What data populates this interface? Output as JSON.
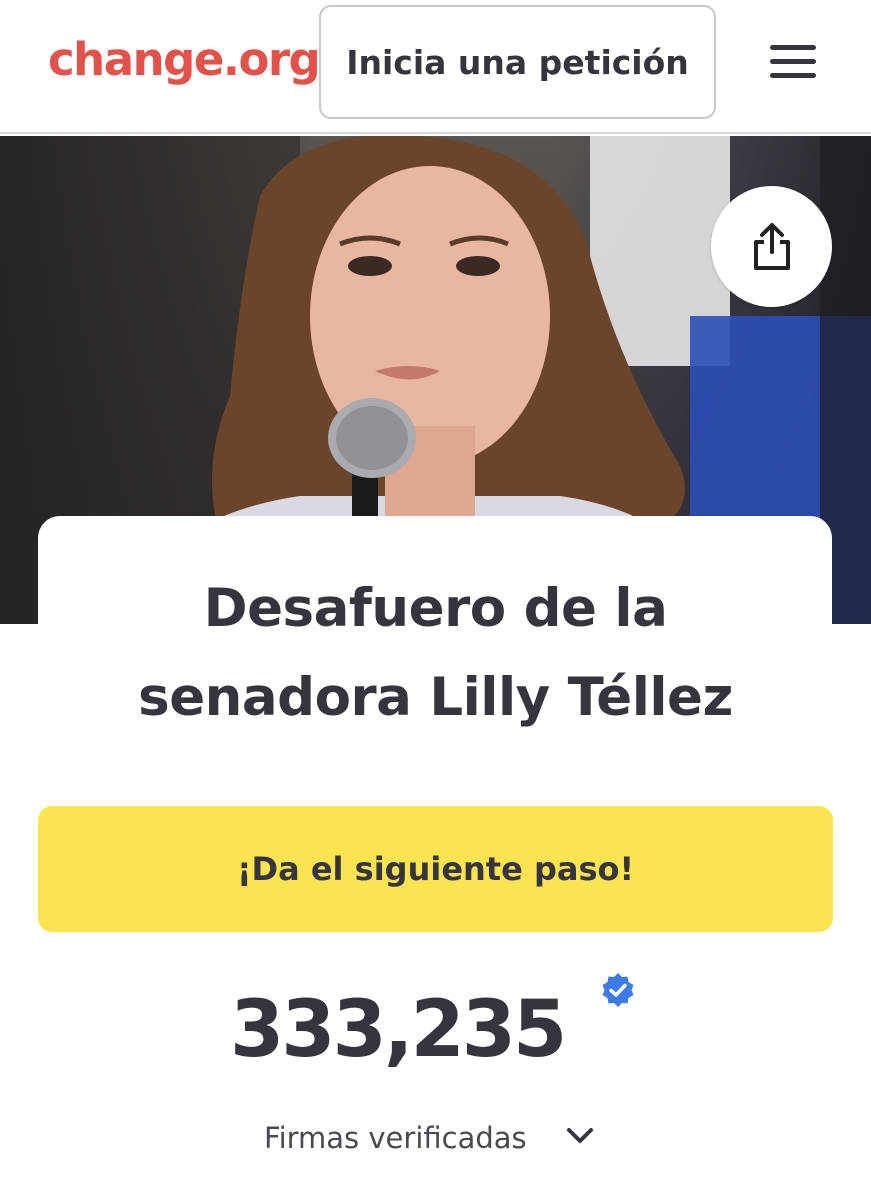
{
  "header": {
    "logo": "change.org",
    "start_petition_label": "Inicia una petición"
  },
  "icons": {
    "menu": "hamburger-menu-icon",
    "share": "share-icon",
    "verified": "verified-badge-icon",
    "expand": "chevron-down-icon"
  },
  "petition": {
    "title_line1": "Desafuero de la",
    "title_line2": "senadora Lilly Téllez",
    "cta_label": "¡Da el siguiente paso!",
    "signature_count": "333,235",
    "signature_label": "Firmas verificadas"
  },
  "colors": {
    "brand": "#e0524a",
    "cta_background": "#fae44f",
    "text": "#36343c",
    "verified": "#3d7be8"
  }
}
